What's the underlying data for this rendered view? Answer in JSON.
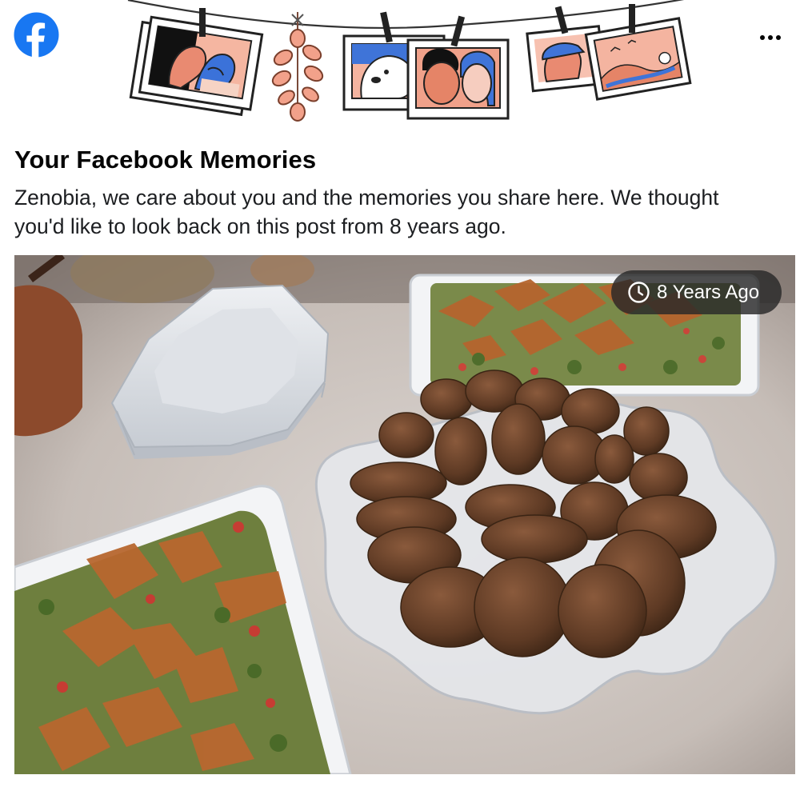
{
  "app": {
    "logo_icon": "facebook-logo-icon",
    "brand_color": "#1877f2",
    "more_icon": "more-options-icon"
  },
  "memory": {
    "title": "Your Facebook Memories",
    "message": "Zenobia, we care about you and the memories you share here. We thought you'd like to look back on this post from 8 years ago.",
    "time_badge": "8 Years Ago",
    "time_icon": "clock-icon"
  }
}
